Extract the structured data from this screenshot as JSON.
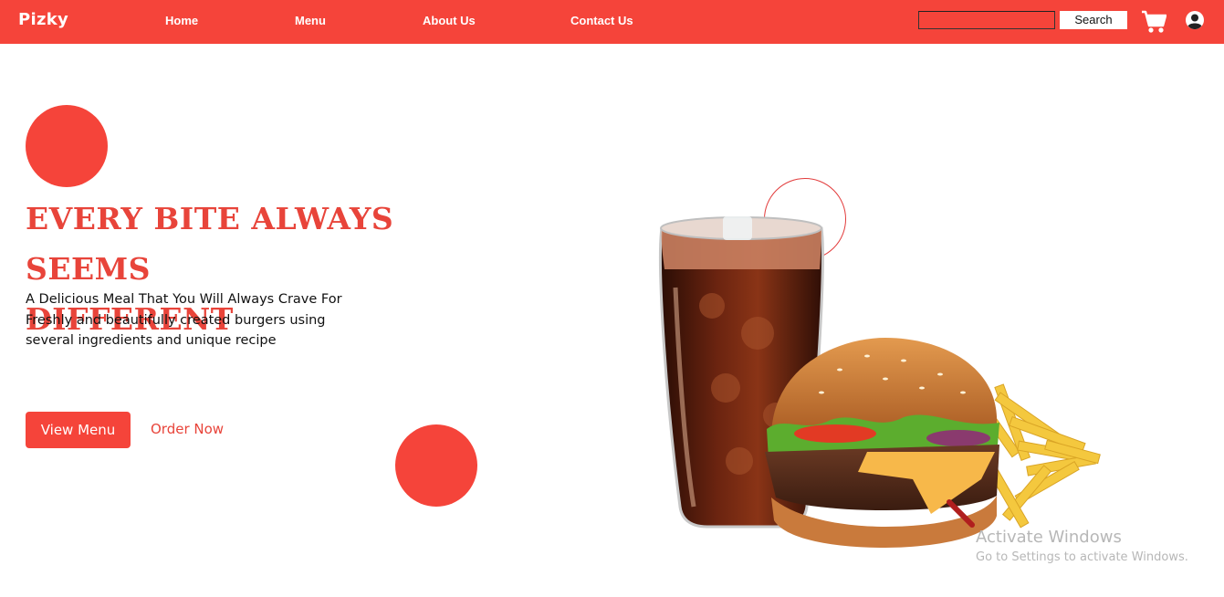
{
  "nav": {
    "brand": "Pizky",
    "links": [
      "Home",
      "Menu",
      "About Us",
      "Contact Us"
    ],
    "search_value": "",
    "search_button": "Search",
    "icons": [
      "cart-icon",
      "user-icon"
    ]
  },
  "hero": {
    "headline_line1": "EVERY BITE ALWAYS SEEMS",
    "headline_line2": "DIFFERENT",
    "tagline_line1": "A Delicious Meal That You Will Always Crave For",
    "tagline_line2": "Freshly and beautifully created burgers using",
    "tagline_line3": "several ingredients and unique recipe",
    "primary_button": "View Menu",
    "secondary_button": "Order Now"
  },
  "watermark": {
    "title": "Activate Windows",
    "subtitle": "Go to Settings to activate Windows."
  },
  "colors": {
    "brand_red": "#f5443a",
    "headline_red": "#e8443a",
    "white": "#ffffff"
  }
}
